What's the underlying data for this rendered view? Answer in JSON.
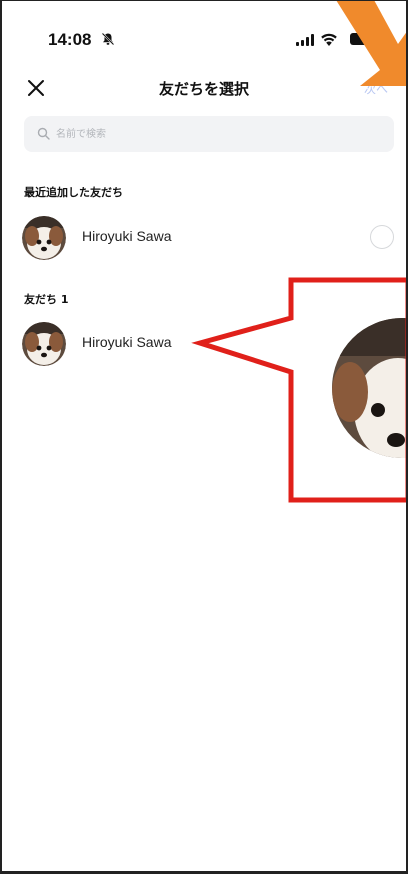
{
  "status_bar": {
    "time": "14:08"
  },
  "header": {
    "close_icon": "close-icon",
    "title": "友だちを選択",
    "next_label": "次へ"
  },
  "search": {
    "placeholder": "名前で検索"
  },
  "sections": {
    "recent_title": "最近追加した友だち",
    "friends_title": "友だち 1"
  },
  "recent_friends": [
    {
      "name": "Hiroyuki Sawa",
      "selected": false
    }
  ],
  "friends": [
    {
      "name": "Hiroyuki Sawa"
    }
  ],
  "colors": {
    "next_disabled": "#b9c7f2",
    "annotation_red": "#e0201a",
    "annotation_orange": "#f08a2c"
  }
}
